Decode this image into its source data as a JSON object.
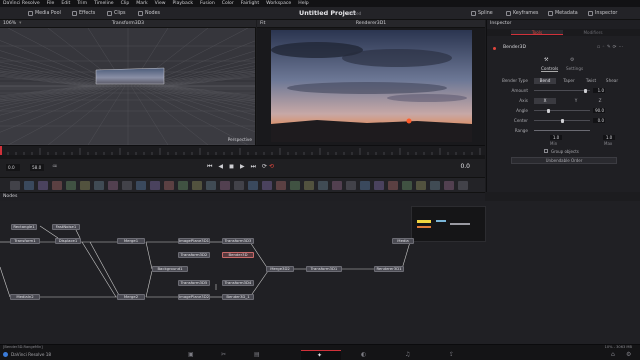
{
  "menu": [
    "DaVinci Resolve",
    "File",
    "Edit",
    "Trim",
    "Timeline",
    "Clip",
    "Mark",
    "View",
    "Playback",
    "Fusion",
    "Color",
    "Fairlight",
    "Workspace",
    "Help"
  ],
  "toolbar": {
    "left": [
      {
        "label": "Media Pool",
        "icon": "media-pool-icon"
      },
      {
        "label": "Effects",
        "icon": "effects-icon"
      },
      {
        "label": "Clips",
        "icon": "clips-icon"
      },
      {
        "label": "Nodes",
        "icon": "nodes-icon"
      }
    ],
    "project_title": "Untitled Project",
    "project_status": "Edited",
    "right": [
      {
        "label": "Spline",
        "icon": "spline-icon"
      },
      {
        "label": "Keyframes",
        "icon": "keyframes-icon"
      },
      {
        "label": "Metadata",
        "icon": "metadata-icon"
      },
      {
        "label": "Inspector",
        "icon": "inspector-icon"
      }
    ]
  },
  "viewer_left": {
    "zoom": "106%",
    "title": "Transform3D3",
    "overlay": "Perspective"
  },
  "viewer_right": {
    "zoom": "Fit",
    "title": "Renderer3D1"
  },
  "inspector": {
    "header": "Inspector",
    "tabs": [
      "Tools",
      "Modifiers"
    ],
    "node_name": "Bender3D",
    "subtabs": [
      "Controls",
      "Settings"
    ],
    "bender_type_label": "Bender Type",
    "bender_types": [
      "Bend",
      "Taper",
      "Twist",
      "Shear"
    ],
    "rows": [
      {
        "label": "Amount",
        "value": "1.0",
        "knob": 0.95
      },
      {
        "label": "Axis",
        "options": [
          "X",
          "Y",
          "Z"
        ]
      },
      {
        "label": "Angle",
        "value": "90.0",
        "knob": 0.25
      },
      {
        "label": "Center",
        "value": "0.0",
        "knob": 0.5
      },
      {
        "label": "Range"
      }
    ],
    "range_min_value": "1.0",
    "range_max_value": "1.0",
    "range_min_label": "Min",
    "range_max_label": "Max",
    "group_objects": "Group objects",
    "button": "Unbendable Order"
  },
  "transport": {
    "start": "0.0",
    "end": "58.0",
    "current": "0.0"
  },
  "nodes_header": "Nodes",
  "nodes": [
    {
      "name": "Rectangle1"
    },
    {
      "name": "FastNoise1"
    },
    {
      "name": "Transform1"
    },
    {
      "name": "Displace1"
    },
    {
      "name": "Merge1"
    },
    {
      "name": "ImagePlane3D1"
    },
    {
      "name": "Transform3D3"
    },
    {
      "name": "Transform3D2"
    },
    {
      "name": "Bender3D"
    },
    {
      "name": "Background1"
    },
    {
      "name": "Merge3D2"
    },
    {
      "name": "Transform3D1"
    },
    {
      "name": "Renderer3D1"
    },
    {
      "name": "Media"
    },
    {
      "name": "Transform3D5"
    },
    {
      "name": "Transform3D4"
    },
    {
      "name": "ImagePlane3D2"
    },
    {
      "name": "Bender3D_1"
    },
    {
      "name": "Merge2"
    },
    {
      "name": "MediaIn2"
    }
  ],
  "status": {
    "left": "[Bender3D.RangeMin]",
    "right": "10% - 3063 MB"
  },
  "footer": {
    "app_name": "DaVinci Resolve 18"
  },
  "colors": {
    "accent": "#e0453c",
    "selected_tab": "#d0313a",
    "sky_top": "#2a3346",
    "sunset": "#d26a3a"
  }
}
